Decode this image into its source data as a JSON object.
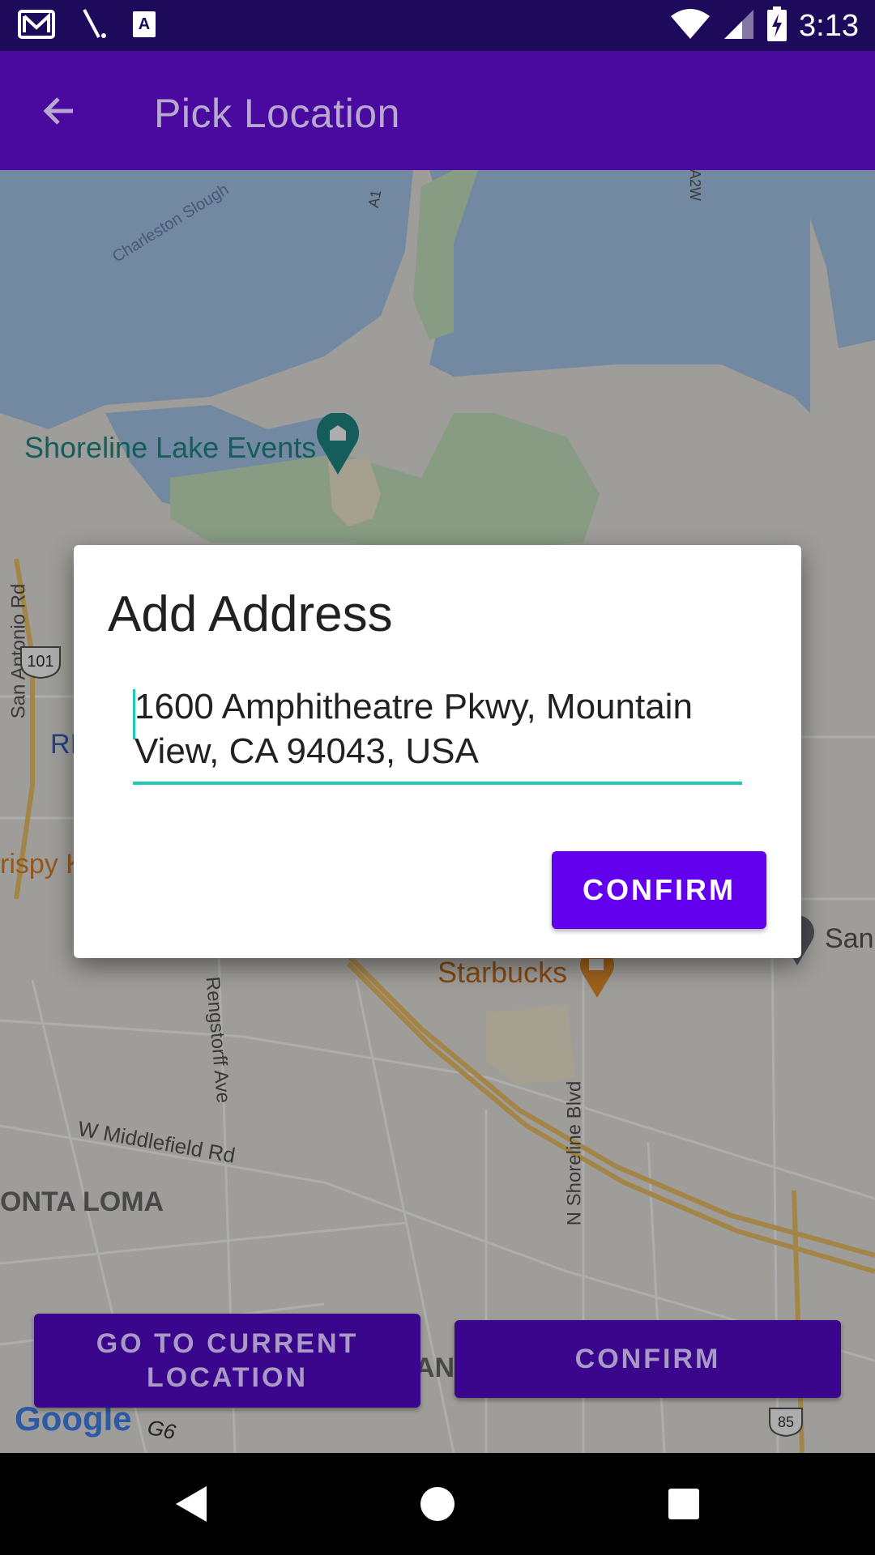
{
  "status_bar": {
    "time": "3:13",
    "icons": [
      "gmail-icon",
      "signal-slash-icon",
      "keyboard-a-icon",
      "wifi-icon",
      "cell-signal-icon",
      "battery-charging-icon"
    ]
  },
  "app_bar": {
    "title": "Pick Location",
    "back_icon": "arrow-back-icon"
  },
  "map": {
    "labels": {
      "charleston_slough": "Charleston Slough",
      "shoreline_lake": "Shoreline Lake Events",
      "starbucks": "Starbucks",
      "rengstorff": "Rengstorff Ave",
      "middlefield": "W Middlefield Rd",
      "shoreline_blvd": "N Shoreline Blvd",
      "monta_loma": "ONTA LOMA",
      "krispy": "rispy K",
      "san_antonio": "San Antonio Rd",
      "r_label": "RI",
      "san_right": "San",
      "route_101": "101",
      "route_85": "85",
      "a2w": "A2W",
      "a1": "A1",
      "g6": "G6",
      "anc": "ANC",
      "google": "Google"
    }
  },
  "buttons": {
    "go_current": "GO TO CURRENT LOCATION",
    "confirm_map": "CONFIRM"
  },
  "dialog": {
    "title": "Add Address",
    "address_value": "1600 Amphitheatre Pkwy, Mountain View, CA 94043, USA",
    "confirm_label": "CONFIRM"
  },
  "colors": {
    "status_bar": "#1e0a5a",
    "app_bar": "#4a0aa0",
    "accent": "#6200ee",
    "field_underline": "#1fc7b8"
  }
}
